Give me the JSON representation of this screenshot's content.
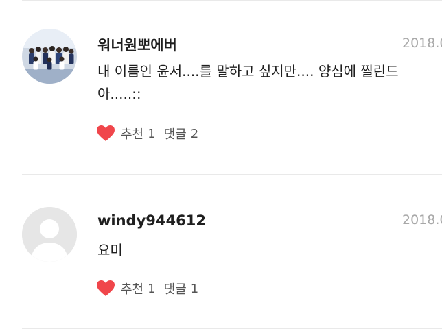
{
  "comments": [
    {
      "author": "워너원뽀에버",
      "date": "2018.0",
      "text": "내 이름인 윤서....를 말하고 싶지만.... 양심에 찔린드아.....::",
      "like_label": "추천",
      "like_count": "1",
      "reply_label": "댓글",
      "reply_count": "2",
      "avatar": "group-photo"
    },
    {
      "author": "windy944612",
      "date": "2018.0",
      "text": "요미",
      "like_label": "추천",
      "like_count": "1",
      "reply_label": "댓글",
      "reply_count": "1",
      "avatar": "default-user-icon"
    }
  ],
  "colors": {
    "heart": "#f0464b",
    "divider": "#e9e9e9",
    "date": "#a8a8a8",
    "avatar_placeholder": "#e6e6e6"
  }
}
